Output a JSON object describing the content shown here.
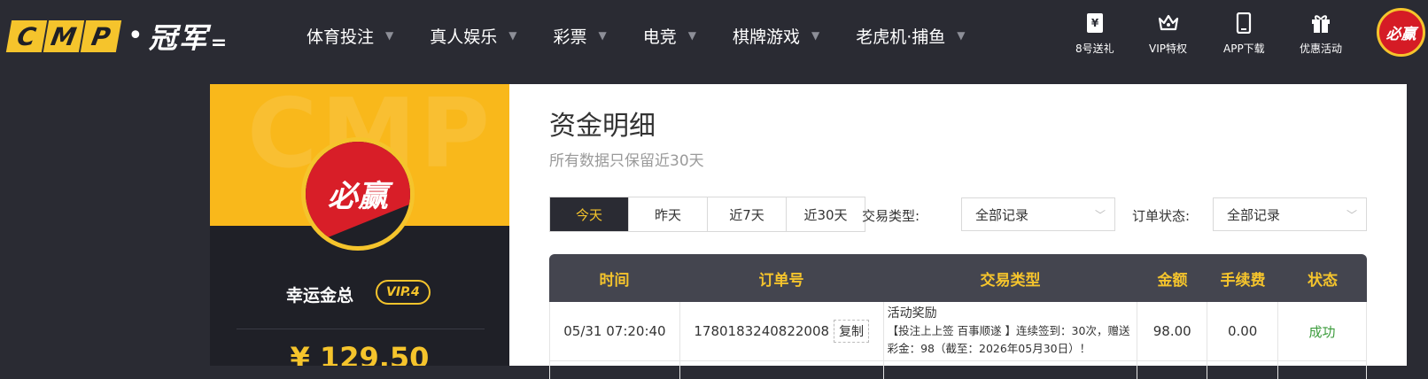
{
  "brand": {
    "logo_letters": [
      "C",
      "M",
      "P"
    ],
    "logo_cn": "冠军",
    "accent": "#f5c42c",
    "bg": "#2a2b33"
  },
  "nav": {
    "items": [
      {
        "label": "体育投注"
      },
      {
        "label": "真人娱乐"
      },
      {
        "label": "彩票"
      },
      {
        "label": "电竞"
      },
      {
        "label": "棋牌游戏"
      },
      {
        "label": "老虎机·捕鱼"
      }
    ]
  },
  "tools": {
    "gift": "8号送礼",
    "vip": "VIP特权",
    "app": "APP下载",
    "promo": "优惠活动"
  },
  "avatar_text": "必赢",
  "profile": {
    "watermark": "CMP",
    "name": "幸运金总",
    "vip": "VIP.4",
    "balance": "¥ 129.50"
  },
  "main": {
    "title": "资金明细",
    "subtitle": "所有数据只保留近30天",
    "tabs": [
      {
        "label": "今天",
        "active": true
      },
      {
        "label": "昨天",
        "active": false
      },
      {
        "label": "近7天",
        "active": false
      },
      {
        "label": "近30天",
        "active": false
      }
    ],
    "filter_type_label": "交易类型:",
    "filter_type_value": "全部记录",
    "filter_status_label": "订单状态:",
    "filter_status_value": "全部记录",
    "table": {
      "headers": [
        "时间",
        "订单号",
        "交易类型",
        "金额",
        "手续费",
        "状态"
      ],
      "rows": [
        {
          "time": "05/31 07:20:40",
          "order": "1780183240822008",
          "copy": "复制",
          "type_title": "活动奖励",
          "type_detail": "【投注上上签 百事顺遂 】连续签到：30次，赠送彩金：98（截至：2026年05月30日）！",
          "amount": "98.00",
          "fee": "0.00",
          "status": "成功"
        }
      ]
    }
  }
}
